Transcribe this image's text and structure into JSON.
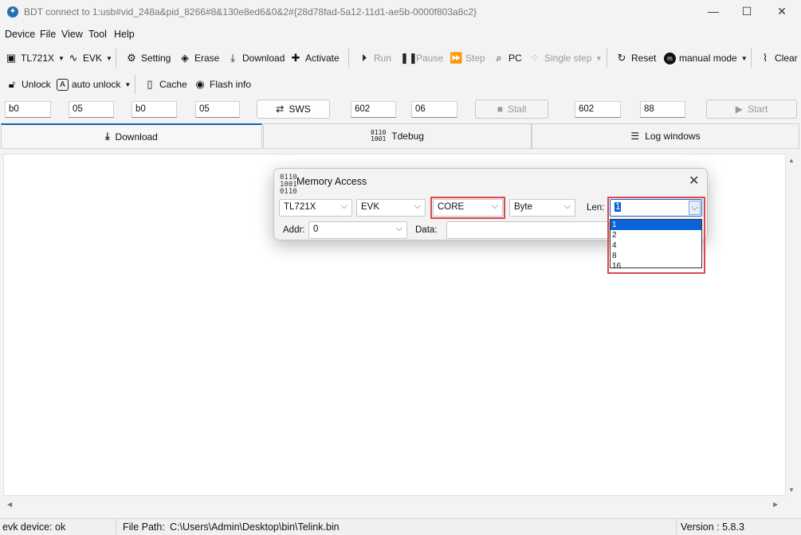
{
  "window": {
    "title": "BDT connect to 1:usb#vid_248a&pid_8266#8&130e8ed6&0&2#{28d78fad-5a12-11d1-ae5b-0000f803a8c2}",
    "minimize_glyph": "—",
    "maximize_glyph": "☐",
    "close_glyph": "✕"
  },
  "menu": [
    "Device",
    "File",
    "View",
    "Tool",
    "Help"
  ],
  "toolbar1": {
    "chip": "TL721X",
    "board": "EVK",
    "setting": "Setting",
    "erase": "Erase",
    "download": "Download",
    "activate": "Activate",
    "run": "Run",
    "pause": "Pause",
    "step": "Step",
    "pc": "PC",
    "single_step": "Single step",
    "reset": "Reset",
    "manual_mode": "manual mode",
    "clear": "Clear"
  },
  "toolbar2": {
    "unlock": "Unlock",
    "auto_unlock": "auto unlock",
    "cache": "Cache",
    "flash_info": "Flash info"
  },
  "fields": {
    "f1": "b0",
    "f2": "05",
    "f3": "b0",
    "f4": "05",
    "sws": "SWS",
    "f5": "602",
    "f6": "06",
    "stall": "Stall",
    "f7": "602",
    "f8": "88",
    "start": "Start"
  },
  "tabs": [
    "Download",
    "Tdebug",
    "Log windows"
  ],
  "status": {
    "device": "evk device: ok",
    "file_label": "File Path:",
    "file_path": "C:\\Users\\Admin\\Desktop\\bin\\Telink.bin",
    "version": "Version : 5.8.3"
  },
  "dialog": {
    "title": "Memory Access",
    "chip": "TL721X",
    "board": "EVK",
    "region": "CORE",
    "unit": "Byte",
    "len_label": "Len:",
    "len_value": "1",
    "len_options": [
      "1",
      "2",
      "4",
      "8",
      "16"
    ],
    "addr_label": "Addr:",
    "addr_value": "0",
    "data_label": "Data:",
    "data_value": ""
  },
  "highlight_color": "#e0474c",
  "accent": "#0a64d8"
}
